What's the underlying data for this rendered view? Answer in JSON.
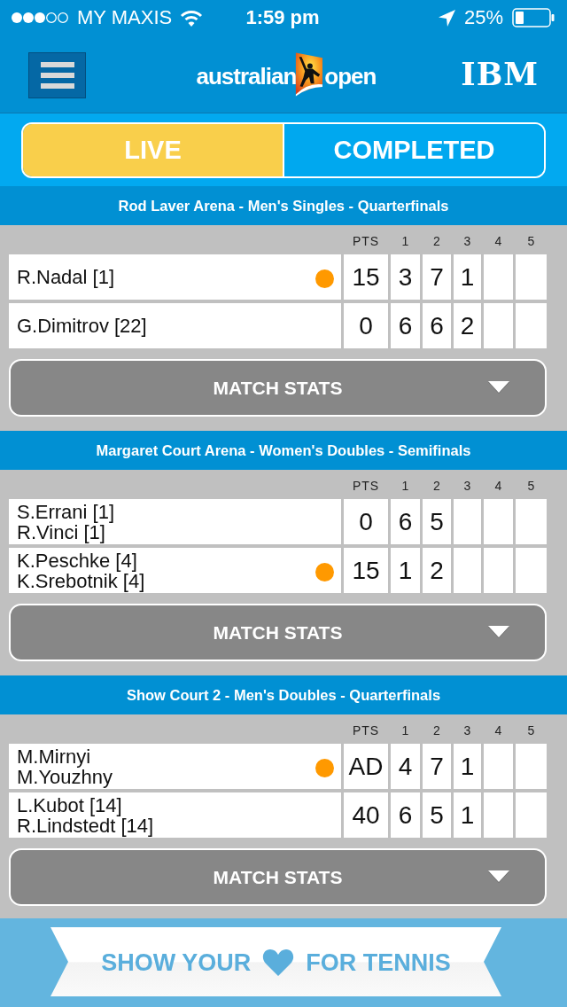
{
  "status_bar": {
    "carrier": "MY MAXIS",
    "time": "1:59 pm",
    "battery": "25%"
  },
  "header": {
    "logo_left": "australian",
    "logo_right": "open",
    "sponsor": "IBM"
  },
  "tabs": [
    {
      "label": "LIVE",
      "selected": true
    },
    {
      "label": "COMPLETED",
      "selected": false
    }
  ],
  "matches": [
    {
      "title": "Rod Laver Arena - Men's Singles - Quarterfinals",
      "points_label": "PTS",
      "set_labels": [
        "1",
        "2",
        "3",
        "4",
        "5"
      ],
      "teams": [
        {
          "players": [
            "R.Nadal [1]"
          ],
          "serving": true,
          "points": "15",
          "sets": [
            "3",
            "7",
            "1"
          ]
        },
        {
          "players": [
            "G.Dimitrov [22]"
          ],
          "serving": false,
          "points": "0",
          "sets": [
            "6",
            "6",
            "2"
          ]
        }
      ],
      "button": "MATCH STATS"
    },
    {
      "title": "Margaret Court Arena - Women's Doubles - Semifinals",
      "points_label": "PTS",
      "set_labels": [
        "1",
        "2",
        "3",
        "4",
        "5"
      ],
      "teams": [
        {
          "players": [
            "S.Errani [1]",
            "R.Vinci [1]"
          ],
          "serving": false,
          "points": "0",
          "sets": [
            "6",
            "5"
          ]
        },
        {
          "players": [
            "K.Peschke [4]",
            "K.Srebotnik [4]"
          ],
          "serving": true,
          "points": "15",
          "sets": [
            "1",
            "2"
          ]
        }
      ],
      "button": "MATCH STATS"
    },
    {
      "title": "Show Court 2 - Men's Doubles - Quarterfinals",
      "points_label": "PTS",
      "set_labels": [
        "1",
        "2",
        "3",
        "4",
        "5"
      ],
      "teams": [
        {
          "players": [
            "M.Mirnyi",
            "M.Youzhny"
          ],
          "serving": true,
          "points": "AD",
          "sets": [
            "4",
            "7",
            "1"
          ]
        },
        {
          "players": [
            "L.Kubot [14]",
            "R.Lindstedt [14]"
          ],
          "serving": false,
          "points": "40",
          "sets": [
            "6",
            "5",
            "1"
          ]
        }
      ],
      "button": "MATCH STATS"
    }
  ],
  "banner": {
    "left": "SHOW YOUR",
    "right": "FOR TENNIS"
  }
}
